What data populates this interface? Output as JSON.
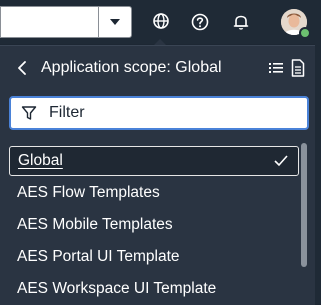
{
  "header": {
    "scope_value": "",
    "icons": [
      "chevron-down-icon",
      "globe-icon",
      "help-icon",
      "bell-icon",
      "avatar"
    ],
    "status_color": "#6cc070"
  },
  "scope_panel": {
    "title": "Application scope: Global",
    "filter_placeholder": "Filter",
    "options": [
      {
        "label": "Global",
        "selected": true
      },
      {
        "label": "AES Flow Templates",
        "selected": false
      },
      {
        "label": "AES Mobile Templates",
        "selected": false
      },
      {
        "label": "AES Portal UI Template",
        "selected": false
      },
      {
        "label": "AES Workspace UI Template",
        "selected": false
      }
    ]
  },
  "colors": {
    "background": "#1d2733",
    "panel": "#2a3442",
    "focus_ring": "#4a82d8"
  }
}
